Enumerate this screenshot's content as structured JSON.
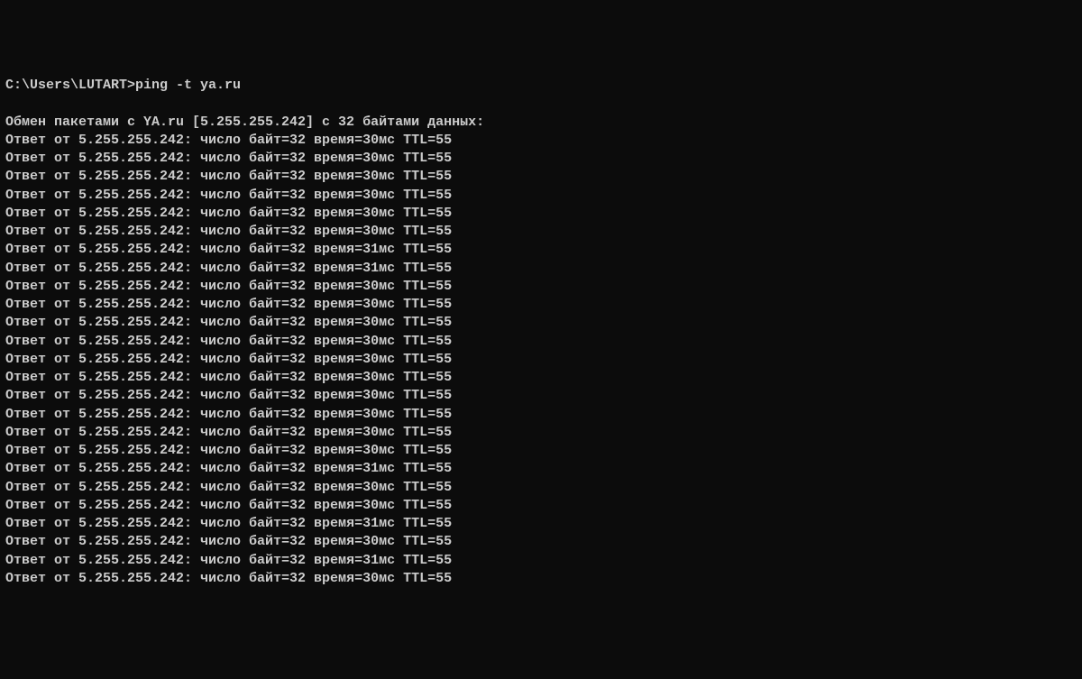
{
  "prompt": "C:\\Users\\LUTART>ping -t ya.ru",
  "header": "Обмен пакетами с YA.ru [5.255.255.242] с 32 байтами данных:",
  "ip": "5.255.255.242",
  "bytes": 32,
  "ttl": 55,
  "reply_template": "Ответ от {ip}: число байт={bytes} время={time}мс TTL={ttl}",
  "replies": [
    {
      "time": 30
    },
    {
      "time": 30
    },
    {
      "time": 30
    },
    {
      "time": 30
    },
    {
      "time": 30
    },
    {
      "time": 30
    },
    {
      "time": 31
    },
    {
      "time": 31
    },
    {
      "time": 30
    },
    {
      "time": 30
    },
    {
      "time": 30
    },
    {
      "time": 30
    },
    {
      "time": 30
    },
    {
      "time": 30
    },
    {
      "time": 30
    },
    {
      "time": 30
    },
    {
      "time": 30
    },
    {
      "time": 30
    },
    {
      "time": 31
    },
    {
      "time": 30
    },
    {
      "time": 30
    },
    {
      "time": 31
    },
    {
      "time": 30
    },
    {
      "time": 31
    },
    {
      "time": 30
    }
  ]
}
